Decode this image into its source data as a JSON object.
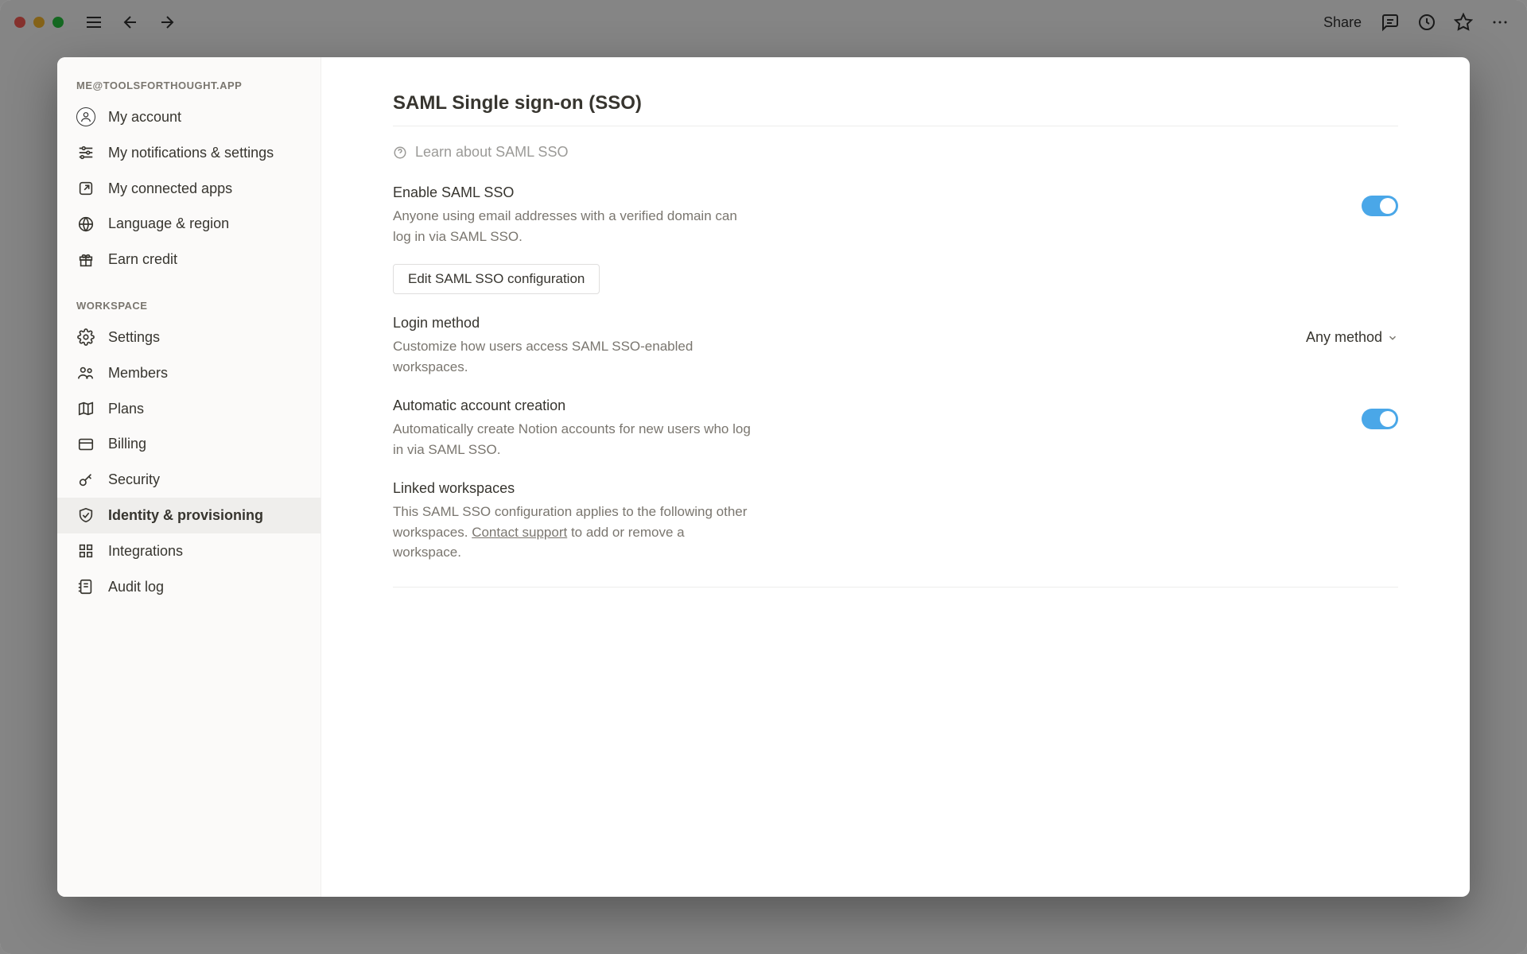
{
  "topbar": {
    "share_label": "Share"
  },
  "sidebar": {
    "account_header": "ME@TOOLSFORTHOUGHT.APP",
    "workspace_header": "WORKSPACE",
    "account_items": [
      {
        "label": "My account"
      },
      {
        "label": "My notifications & settings"
      },
      {
        "label": "My connected apps"
      },
      {
        "label": "Language & region"
      },
      {
        "label": "Earn credit"
      }
    ],
    "workspace_items": [
      {
        "label": "Settings"
      },
      {
        "label": "Members"
      },
      {
        "label": "Plans"
      },
      {
        "label": "Billing"
      },
      {
        "label": "Security"
      },
      {
        "label": "Identity & provisioning"
      },
      {
        "label": "Integrations"
      },
      {
        "label": "Audit log"
      }
    ]
  },
  "content": {
    "page_title": "SAML Single sign-on (SSO)",
    "learn_link": "Learn about SAML SSO",
    "enable": {
      "title": "Enable SAML SSO",
      "desc": "Anyone using email addresses with a verified domain can log in via SAML SSO."
    },
    "edit_button": "Edit SAML SSO configuration",
    "login_method": {
      "title": "Login method",
      "desc": "Customize how users access SAML SSO-enabled workspaces.",
      "value": "Any method"
    },
    "auto_create": {
      "title": "Automatic account creation",
      "desc": "Automatically create Notion accounts for new users who log in via SAML SSO."
    },
    "linked": {
      "title": "Linked workspaces",
      "desc_a": "This SAML SSO configuration applies to the following other workspaces. ",
      "desc_link": "Contact support",
      "desc_b": " to add or remove a workspace."
    }
  }
}
